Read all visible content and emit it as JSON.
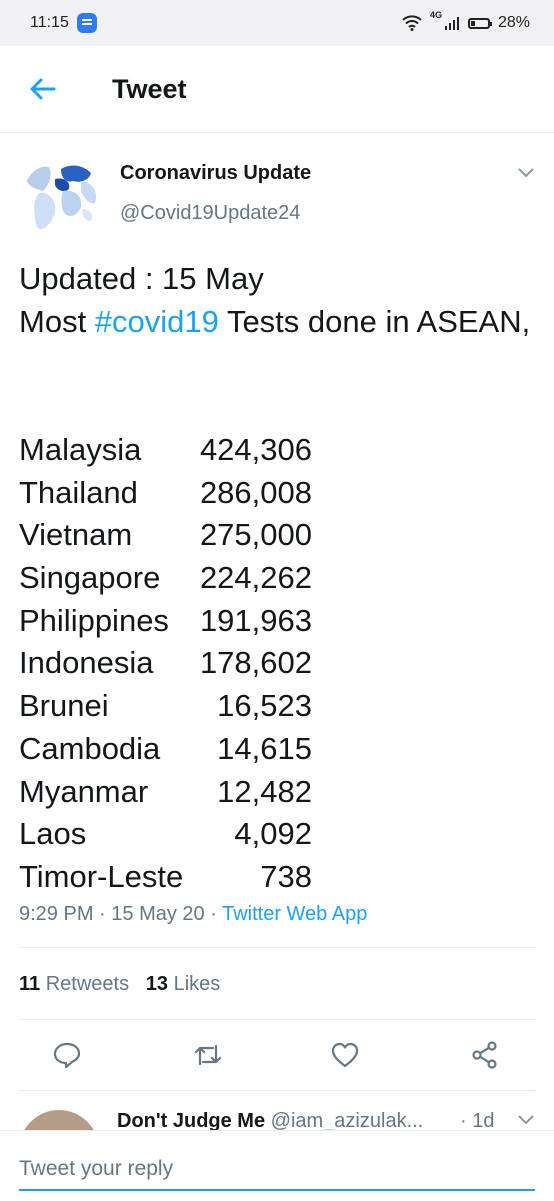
{
  "status_bar": {
    "time": "11:15",
    "network": "4G",
    "battery": "28%",
    "battery_level": 0.28
  },
  "header": {
    "title": "Tweet"
  },
  "tweet": {
    "author": {
      "name": "Coronavirus Update",
      "handle": "@Covid19Update24"
    },
    "text_line1": "Updated : 15 May",
    "text_prefix": "Most ",
    "hashtag": "#covid19",
    "text_suffix": " Tests done in ASEAN,",
    "tests": [
      {
        "country": "Malaysia",
        "count": "424,306"
      },
      {
        "country": "Thailand",
        "count": "286,008"
      },
      {
        "country": "Vietnam",
        "count": "275,000"
      },
      {
        "country": "Singapore",
        "count": "224,262"
      },
      {
        "country": "Philippines",
        "count": "191,963"
      },
      {
        "country": "Indonesia",
        "count": "178,602"
      },
      {
        "country": "Brunei",
        "count": "16,523"
      },
      {
        "country": "Cambodia",
        "count": "14,615"
      },
      {
        "country": "Myanmar",
        "count": "12,482"
      },
      {
        "country": "Laos",
        "count": "4,092"
      },
      {
        "country": "Timor-Leste",
        "count": "738"
      }
    ],
    "time": "9:29 PM",
    "date": "15 May 20",
    "source": "Twitter Web App",
    "retweets_count": "11",
    "retweets_label": "Retweets",
    "likes_count": "13",
    "likes_label": "Likes"
  },
  "reply_preview": {
    "name": "Don't Judge Me",
    "handle": "@iam_azizulak...",
    "time": "· 1d"
  },
  "composer": {
    "placeholder": "Tweet your reply"
  },
  "colors": {
    "accent": "#1da1f2",
    "text": "#14171a",
    "muted": "#657786",
    "divider": "#e6ecf0"
  },
  "icons": [
    "message-icon",
    "wifi-icon",
    "signal-icon",
    "battery-icon",
    "back-arrow-icon",
    "chevron-down-icon",
    "reply-icon",
    "retweet-icon",
    "like-icon",
    "share-icon"
  ]
}
